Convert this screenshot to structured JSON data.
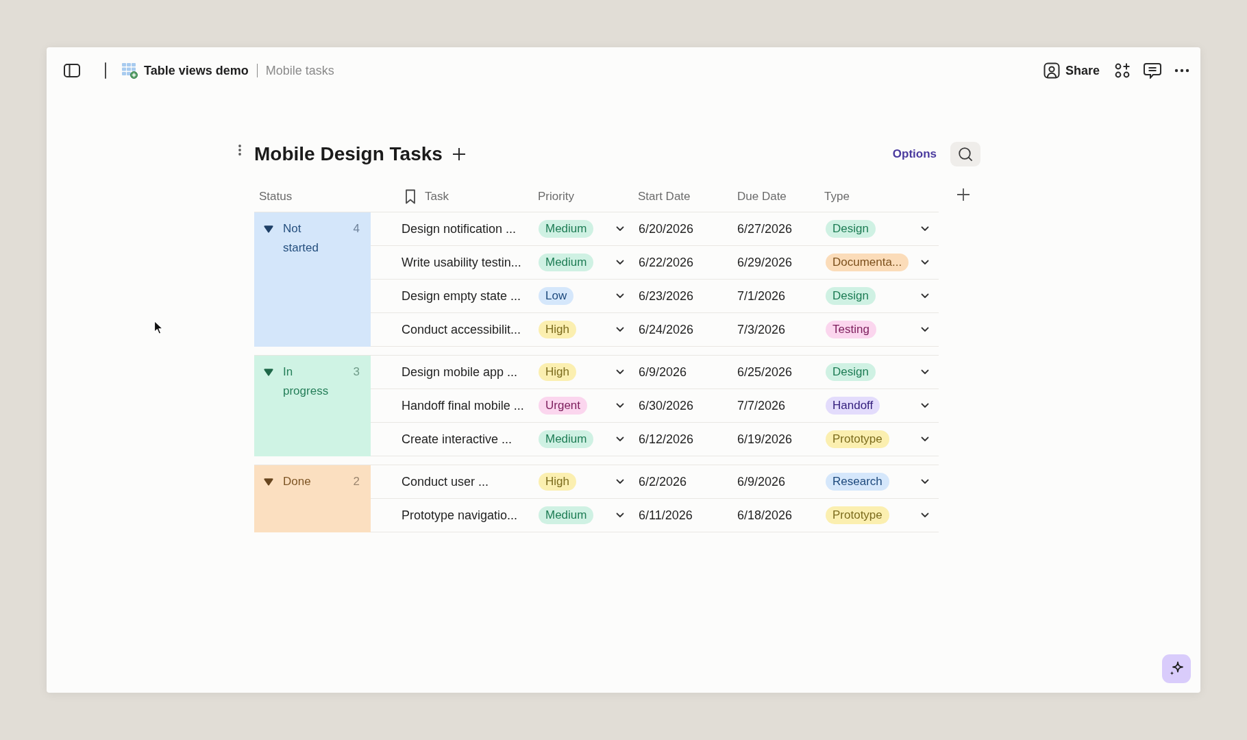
{
  "topbar": {
    "breadcrumb": {
      "document": "Table views demo",
      "view": "Mobile tasks"
    },
    "share_button": {
      "label": "Share"
    }
  },
  "table": {
    "title": "Mobile Design Tasks",
    "options_label": "Options",
    "columns": [
      {
        "label": "Status",
        "kind": "status"
      },
      {
        "label": "Task",
        "kind": "title"
      },
      {
        "label": "Priority",
        "kind": "select"
      },
      {
        "label": "Start Date",
        "kind": "date"
      },
      {
        "label": "Due Date",
        "kind": "date"
      },
      {
        "label": "Type",
        "kind": "select"
      }
    ],
    "groups": [
      {
        "status": "Not started",
        "count": "4",
        "color": "#d4e6fa",
        "expanded": true,
        "rows": [
          {
            "task": "Design notification ...",
            "priority": {
              "label": "Medium",
              "color": "#cff1e3"
            },
            "start_date": "6/20/2026",
            "due_date": "6/27/2026",
            "type": {
              "label": "Design",
              "color": "#cff1e3"
            }
          },
          {
            "task": "Write usability testin...",
            "priority": {
              "label": "Medium",
              "color": "#cff1e3"
            },
            "start_date": "6/22/2026",
            "due_date": "6/29/2026",
            "type": {
              "label": "Documenta...",
              "color": "#fbdcb9"
            }
          },
          {
            "task": "Design empty state ...",
            "priority": {
              "label": "Low",
              "color": "#d5e7fb"
            },
            "start_date": "6/23/2026",
            "due_date": "7/1/2026",
            "type": {
              "label": "Design",
              "color": "#cff1e3"
            }
          },
          {
            "task": "Conduct accessibilit...",
            "priority": {
              "label": "High",
              "color": "#fbefb0"
            },
            "start_date": "6/24/2026",
            "due_date": "7/3/2026",
            "type": {
              "label": "Testing",
              "color": "#fbd6ee"
            }
          }
        ]
      },
      {
        "status": "In progress",
        "count": "3",
        "color": "#cff3e4",
        "expanded": true,
        "rows": [
          {
            "task": "Design mobile app ...",
            "priority": {
              "label": "High",
              "color": "#fbefb0"
            },
            "start_date": "6/9/2026",
            "due_date": "6/25/2026",
            "type": {
              "label": "Design",
              "color": "#cff1e3"
            }
          },
          {
            "task": "Handoff final mobile ...",
            "priority": {
              "label": "Urgent",
              "color": "#fbd6ee"
            },
            "start_date": "6/30/2026",
            "due_date": "7/7/2026",
            "type": {
              "label": "Handoff",
              "color": "#e3dcfc"
            }
          },
          {
            "task": "Create interactive ...",
            "priority": {
              "label": "Medium",
              "color": "#cff1e3"
            },
            "start_date": "6/12/2026",
            "due_date": "6/19/2026",
            "type": {
              "label": "Prototype",
              "color": "#fbefb0"
            }
          }
        ]
      },
      {
        "status": "Done",
        "count": "2",
        "color": "#fbdfc0",
        "expanded": true,
        "rows": [
          {
            "task": "Conduct user ...",
            "priority": {
              "label": "High",
              "color": "#fbefb0"
            },
            "start_date": "6/2/2026",
            "due_date": "6/9/2026",
            "type": {
              "label": "Research",
              "color": "#d5e7fb"
            }
          },
          {
            "task": "Prototype navigatio...",
            "priority": {
              "label": "Medium",
              "color": "#cff1e3"
            },
            "start_date": "6/11/2026",
            "due_date": "6/18/2026",
            "type": {
              "label": "Prototype",
              "color": "#fbefb0"
            }
          }
        ]
      }
    ]
  }
}
